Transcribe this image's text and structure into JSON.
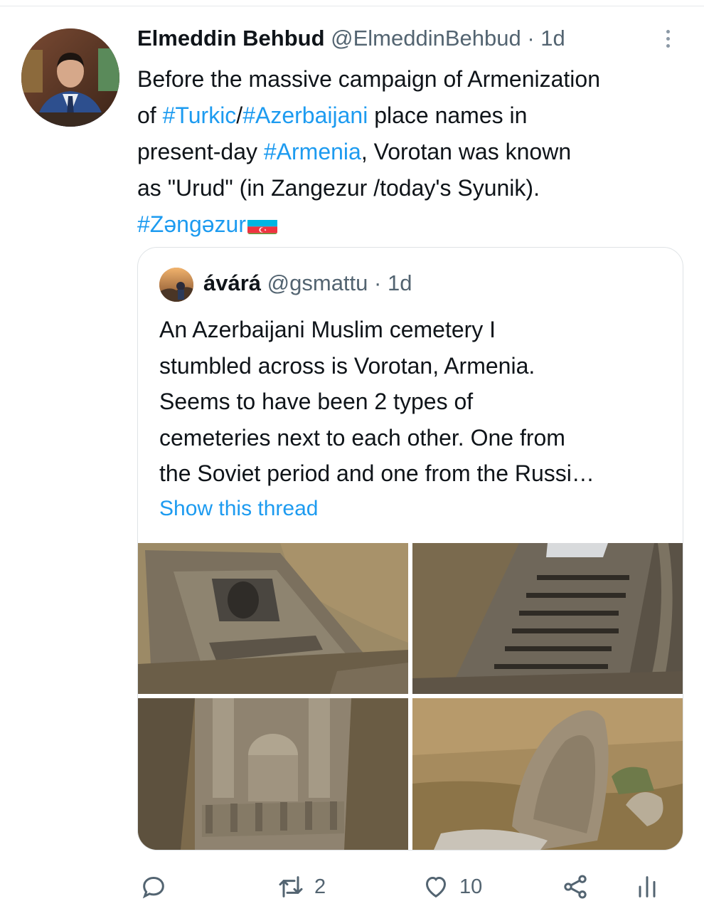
{
  "tweet": {
    "author_name": "Elmeddin Behbud",
    "author_handle": "@ElmeddinBehbud",
    "separator": "·",
    "time": "1d",
    "text_lines": [
      [
        {
          "t": "Before the massive campaign of Armenization",
          "tag": false
        }
      ],
      [
        {
          "t": "of ",
          "tag": false
        },
        {
          "t": "#Turkic",
          "tag": true
        },
        {
          "t": "/",
          "tag": false
        },
        {
          "t": "#Azerbaijani",
          "tag": true
        },
        {
          "t": " place names in",
          "tag": false
        }
      ],
      [
        {
          "t": "present-day ",
          "tag": false
        },
        {
          "t": "#Armenia",
          "tag": true
        },
        {
          "t": ", Vorotan was known",
          "tag": false
        }
      ],
      [
        {
          "t": "as \"Urud\" (in Zangezur /today's Syunik).",
          "tag": false
        }
      ],
      [
        {
          "t": "#Zəngəzur",
          "tag": true
        }
      ]
    ],
    "flag_icon": "azerbaijan-flag-icon"
  },
  "quoted_tweet": {
    "author_name": "ávárá",
    "author_handle": "@gsmattu",
    "separator": "·",
    "time": "1d",
    "text_lines": [
      "An Azerbaijani Muslim cemetery I",
      "stumbled across is Vorotan, Armenia.",
      "Seems to have been 2 types of",
      "cemeteries next to each other. One from",
      "the Soviet period and one from the Russi…"
    ],
    "show_thread": "Show this thread",
    "photos": [
      "cemetery-photo-1",
      "cemetery-photo-2",
      "cemetery-photo-3",
      "cemetery-photo-4"
    ]
  },
  "actions": {
    "reply_count": "",
    "retweet_count": "2",
    "like_count": "10",
    "icons": [
      "reply-icon",
      "retweet-icon",
      "like-icon",
      "share-icon",
      "analytics-icon"
    ]
  },
  "colors": {
    "link": "#1d9bf0",
    "secondary_text": "#536471",
    "primary_text": "#0f1419",
    "border": "#dfe3e6"
  }
}
